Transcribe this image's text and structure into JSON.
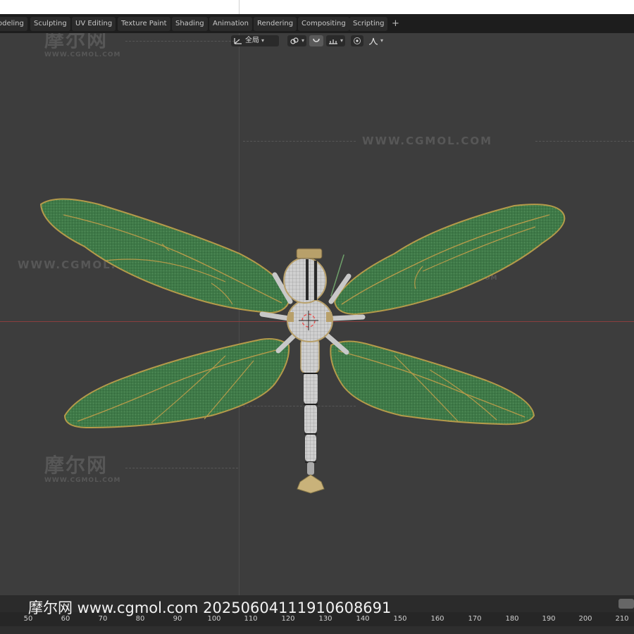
{
  "workspace_tabs": [
    "odeling",
    "Sculpting",
    "UV Editing",
    "Texture Paint",
    "Shading",
    "Animation",
    "Rendering",
    "Compositing",
    "Scripting"
  ],
  "add_tab_label": "+",
  "viewport_header": {
    "transform_orientation": "全局"
  },
  "watermarks": {
    "cn": "摩尔网",
    "cn_url": "WWW.CGMOL.COM",
    "url": "WWW.CGMOL.COM"
  },
  "footer_watermark": "摩尔网 www.cgmol.com 20250604111910608691",
  "timeline": {
    "ruler_ticks": [
      "50",
      "60",
      "70",
      "80",
      "90",
      "100",
      "110",
      "120",
      "130",
      "140",
      "150",
      "160",
      "170",
      "180",
      "190",
      "200",
      "210"
    ]
  },
  "colors": {
    "wing": "#3f7a48",
    "vein": "#b49a4a",
    "body": "#c9c9c9",
    "gold": "#b8a06a",
    "x_axis": "#8a3e3e"
  }
}
